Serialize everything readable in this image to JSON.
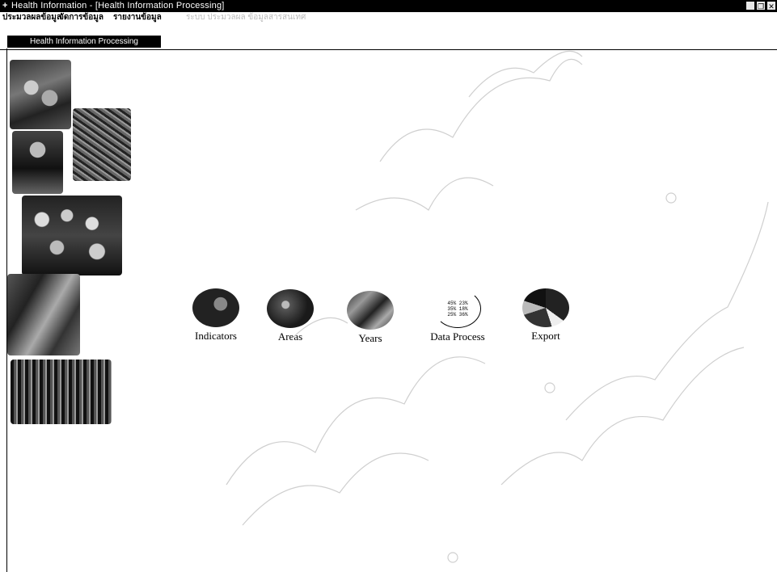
{
  "window": {
    "title": "Health Information - [Health Information Processing]",
    "app_icon": "+",
    "buttons": [
      "_",
      "❐",
      "✕"
    ]
  },
  "menu": {
    "items": [
      "ประมวลผลข้อมูล",
      "จัดการข้อมูล",
      "รายงานข้อมูล"
    ],
    "faded_text": "ระบบ ประมวลผล ข้อมูลสารสนเทศ"
  },
  "tab": {
    "label": "Health Information Processing"
  },
  "icons": [
    {
      "label": "Indicators"
    },
    {
      "label": "Areas"
    },
    {
      "label": "Years"
    },
    {
      "label": "Data Process"
    },
    {
      "label": "Export"
    }
  ],
  "data_icon_lines": [
    "45% 23%",
    "35% 18%",
    "25% 36%"
  ]
}
